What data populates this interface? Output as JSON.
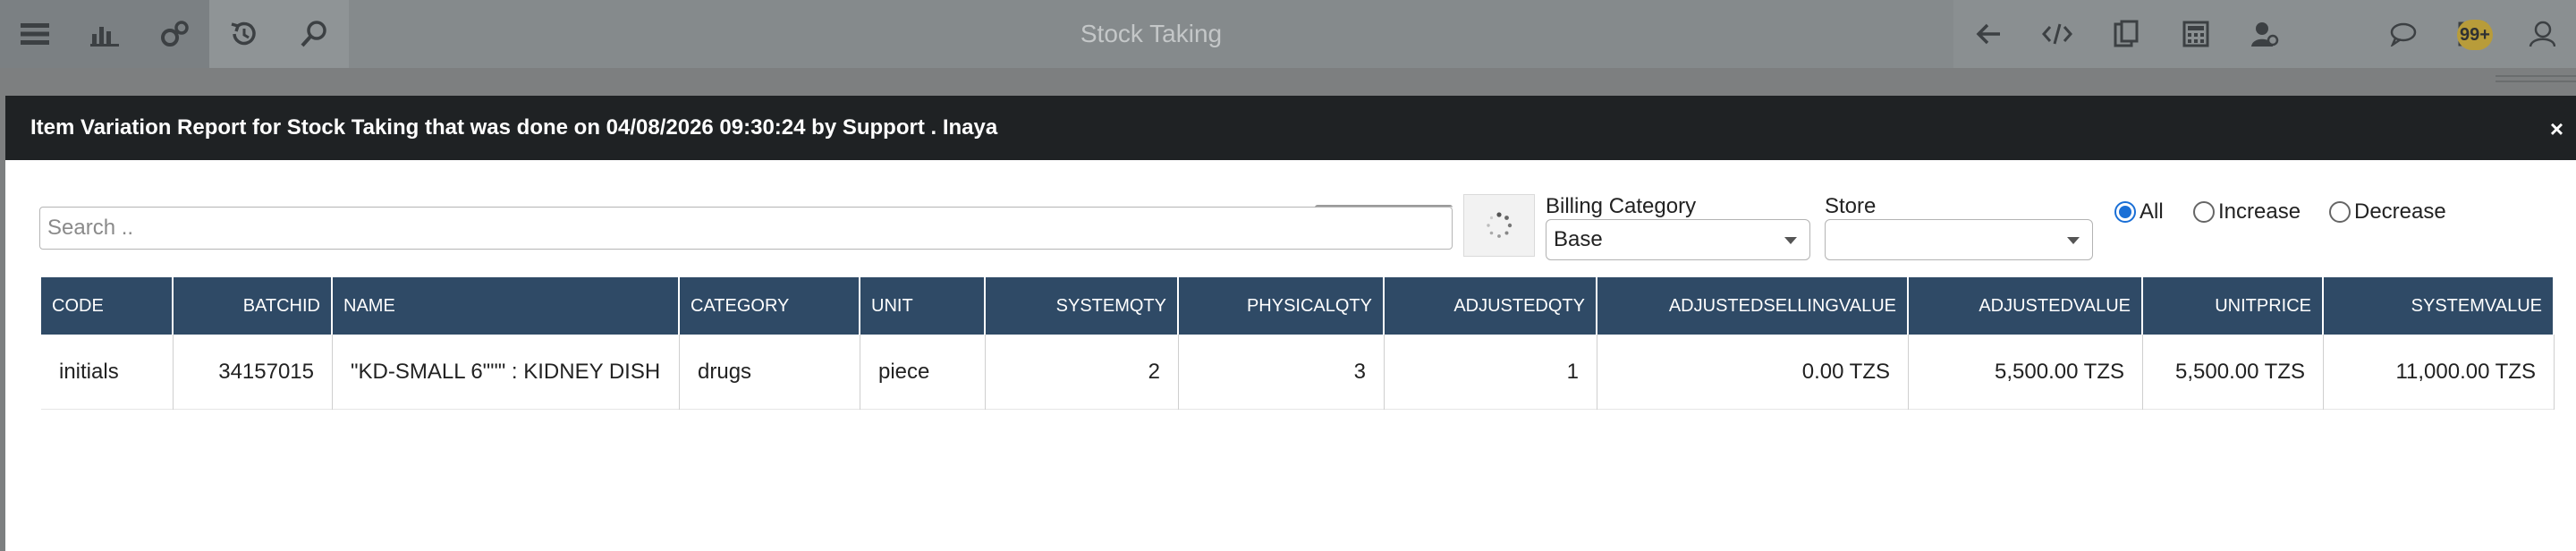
{
  "toolbar": {
    "title": "Stock Taking",
    "left_icons": [
      "menu-icon",
      "bar-chart-icon",
      "gears-icon",
      "history-icon",
      "search-icon"
    ],
    "right_icons": [
      "back-arrow-icon",
      "code-icon",
      "clipboard-icon",
      "calculator-icon",
      "user-settings-icon",
      "chat-icon",
      "mail-icon",
      "user-icon"
    ],
    "badge": "99+"
  },
  "modal": {
    "title": "Item Variation Report for Stock Taking that was done on 04/08/2026 09:30:24 by Support . Inaya",
    "close_glyph": "×"
  },
  "filters": {
    "search_placeholder": "Search ..",
    "billing_category_label": "Billing Category",
    "billing_category_value": "Base",
    "store_label": "Store",
    "store_value": "",
    "radio_options": [
      {
        "label": "All",
        "checked": true
      },
      {
        "label": "Increase",
        "checked": false
      },
      {
        "label": "Decrease",
        "checked": false
      }
    ]
  },
  "table": {
    "columns": [
      "CODE",
      "BATCHID",
      "NAME",
      "CATEGORY",
      "UNIT",
      "SYSTEMQTY",
      "PHYSICALQTY",
      "ADJUSTEDQTY",
      "ADJUSTEDSELLINGVALUE",
      "ADJUSTEDVALUE",
      "UNITPRICE",
      "SYSTEMVALUE"
    ],
    "rows": [
      [
        "initials",
        "34157015",
        "\"KD-SMALL 6\"\"\" : KIDNEY DISH",
        "drugs",
        "piece",
        "2",
        "3",
        "1",
        "0.00 TZS",
        "5,500.00 TZS",
        "5,500.00 TZS",
        "11,000.00 TZS"
      ]
    ]
  }
}
